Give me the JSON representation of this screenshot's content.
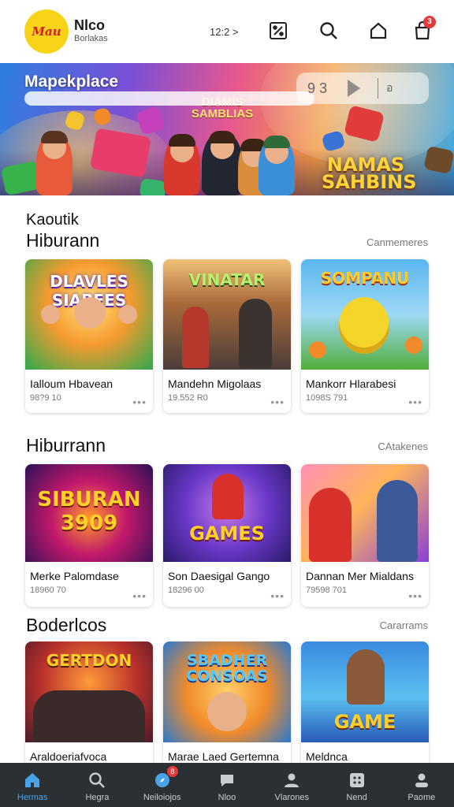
{
  "header": {
    "logo_text": "Mau",
    "brand_name": "Nlco",
    "brand_sub": "Borlakas",
    "meta": "12:2 >",
    "cart_count": "3"
  },
  "banner": {
    "title": "Mapekplace",
    "page_indicator": "9 3",
    "mini_label": "อ",
    "sign_text": "DIAMIS SAMBLIAS",
    "logo_text": "NAMAS SAHBINS"
  },
  "sections": [
    {
      "kicker": "Kaoutik",
      "title": "Hiburann",
      "more": "Canmemeres",
      "cards": [
        {
          "title": "Ialloum Hbavean",
          "meta": "98?9 10",
          "art": "DLAVLES SIABEES"
        },
        {
          "title": "Mandehn Migolaas",
          "meta": "19.552 R0",
          "art": "VINATAR"
        },
        {
          "title": "Mankorr Hlarabesi",
          "meta": "1098S 791",
          "art": "SOMPANU"
        }
      ]
    },
    {
      "title": "Hiburrann",
      "more": "CAtakenes",
      "cards": [
        {
          "title": "Merke Palomdase",
          "meta": "18960 70",
          "art": "SIBURAN 3909"
        },
        {
          "title": "Son Daesigal Gango",
          "meta": "18296 00",
          "art": "GAMES"
        },
        {
          "title": "Dannan Mer Mialdans",
          "meta": "79598 701",
          "art": ""
        }
      ]
    },
    {
      "title": "Boderlcos",
      "more": "Cararrams",
      "cards": [
        {
          "title": "Araldoeriafvoca",
          "art": "GERTDON"
        },
        {
          "title": "Marae Laed Gertemna",
          "art": "SBADHER CONSOAS"
        },
        {
          "title": "Meldnca",
          "art": "GAME"
        }
      ]
    }
  ],
  "nav": {
    "items": [
      {
        "label": "Hermas",
        "icon": "home-icon"
      },
      {
        "label": "Hegra",
        "icon": "search-icon"
      },
      {
        "label": "Neiloiojos",
        "icon": "compass-icon",
        "badge": "8"
      },
      {
        "label": "Nloo",
        "icon": "chat-icon"
      },
      {
        "label": "Vlarones",
        "icon": "person-icon"
      },
      {
        "label": "Nend",
        "icon": "grid-icon"
      },
      {
        "label": "Paome",
        "icon": "profile-icon"
      }
    ]
  },
  "colors": {
    "accent": "#4aa3e6",
    "nav_bg": "#2b3035",
    "badge": "#e23b3b",
    "logo_bg": "#f7d31a"
  }
}
